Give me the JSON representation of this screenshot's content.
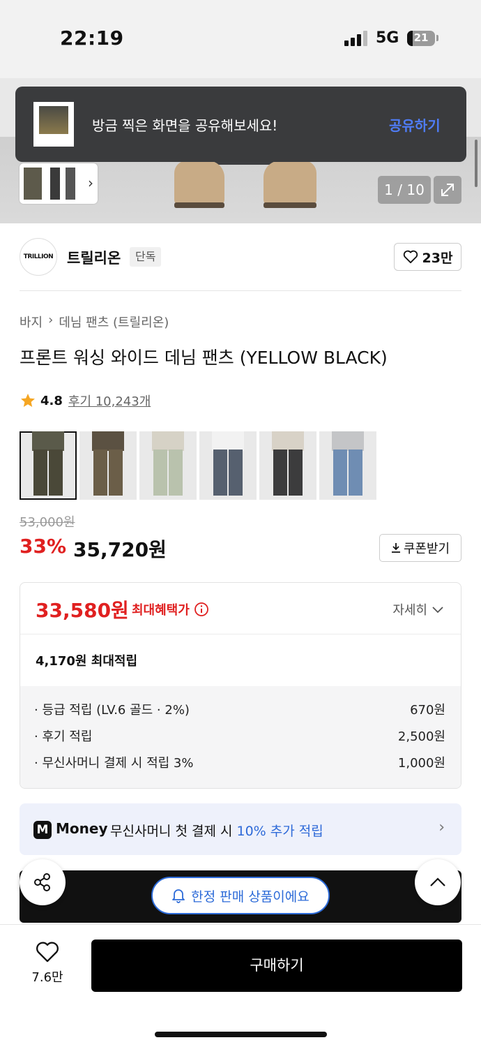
{
  "status_bar": {
    "time": "22:19",
    "network": "5G",
    "battery": "21",
    "battery_level": 0.21
  },
  "gallery": {
    "counter": "1 / 10",
    "thumb_icon": "chevron-right-icon",
    "expand_icon": "expand-icon"
  },
  "toast": {
    "message": "방금 찍은 화면을 공유해보세요!",
    "action": "공유하기"
  },
  "brand": {
    "logo_text": "TRILLION",
    "name": "트릴리온",
    "badge": "단독",
    "likes": "23만"
  },
  "breadcrumb": {
    "category": "바지",
    "sub": "데님 팬츠 (트릴리온)"
  },
  "product": {
    "title": "프론트 워싱 와이드 데님 팬츠 (YELLOW BLACK)",
    "rating": "4.8",
    "reviews": "후기 10,243개",
    "original_price": "53,000원",
    "discount": "33%",
    "price": "35,720원",
    "coupon_label": "쿠폰받기"
  },
  "color_options": [
    {
      "name": "yellow-black",
      "top": "#5a5a4a",
      "leg": "#4a4838"
    },
    {
      "name": "brown-wash",
      "top": "#5b5142",
      "leg": "#6b5e48"
    },
    {
      "name": "light-green-wash",
      "top": "#d6d2c6",
      "leg": "#b9c2ad"
    },
    {
      "name": "mid-blue",
      "top": "#f2f2f2",
      "leg": "#56606f"
    },
    {
      "name": "black-wash",
      "top": "#d8d2c7",
      "leg": "#3c3c3d"
    },
    {
      "name": "light-blue",
      "top": "#c4c5c7",
      "leg": "#6f8db3"
    }
  ],
  "benefit": {
    "max_price": "33,580원",
    "max_label": "최대혜택가",
    "detail": "자세히",
    "points_total": "4,170원 최대적립",
    "items": [
      {
        "label": "· 등급 적립 (LV.6 골드 · 2%)",
        "value": "670원"
      },
      {
        "label": "· 후기 적립",
        "value": "2,500원"
      },
      {
        "label": "· 무신사머니 결제 시 적립 3%",
        "value": "1,000원"
      }
    ]
  },
  "money_banner": {
    "logo": "M",
    "brand": "Money",
    "text": "무신사머니 첫 결제 시 ",
    "highlight": "10% 추가 적립"
  },
  "limited_badge": "한정 판매 상품이에요",
  "bottom": {
    "wish_count": "7.6만",
    "buy_label": "구매하기"
  }
}
